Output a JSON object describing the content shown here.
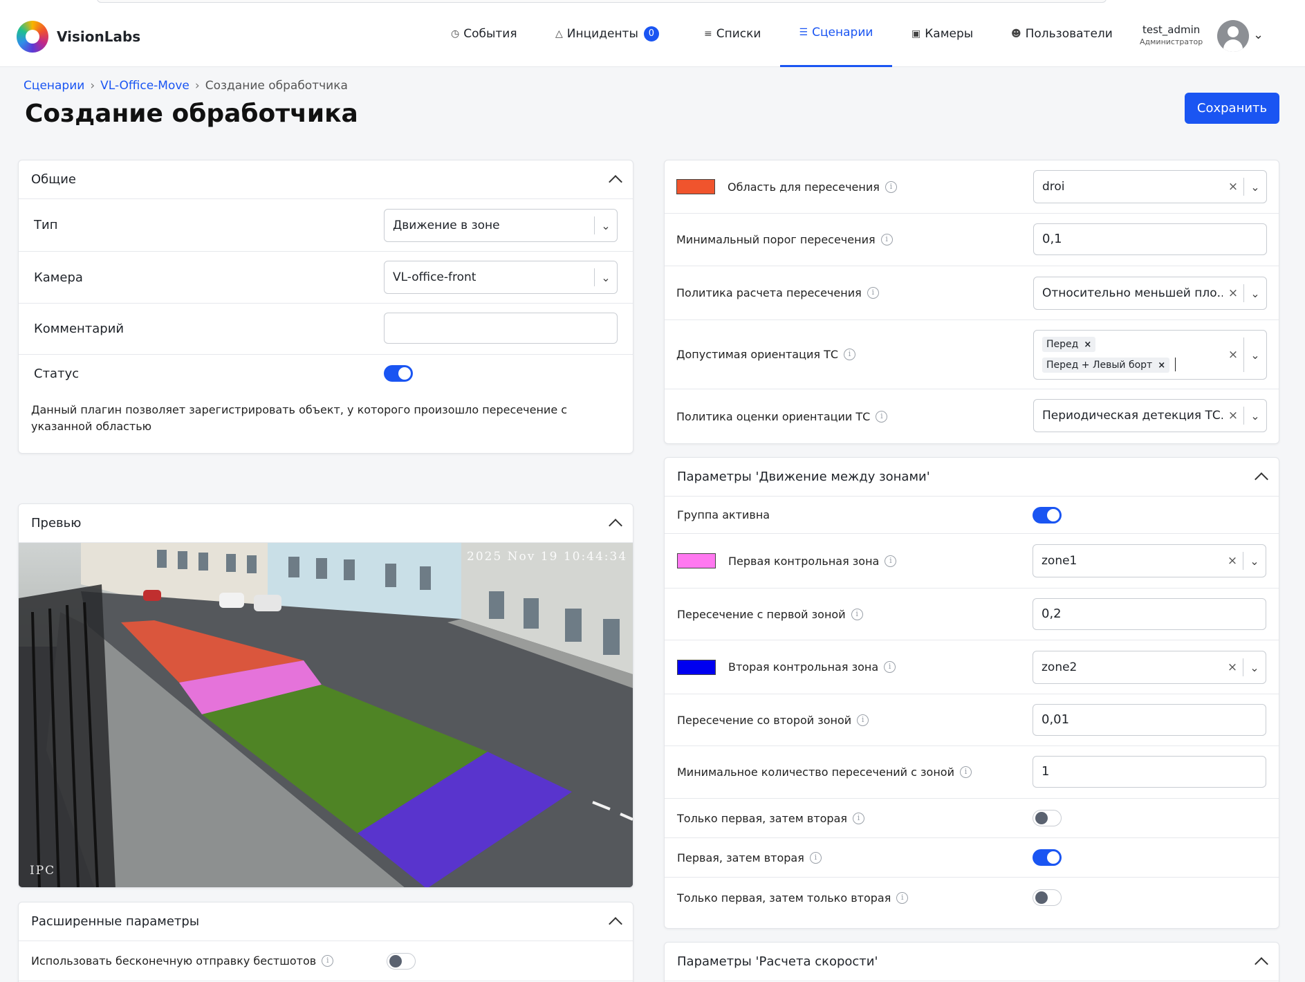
{
  "app": {
    "brand": "VisionLabs"
  },
  "nav": {
    "events": "События",
    "incidents": "Инциденты",
    "incidents_count": "0",
    "lists": "Списки",
    "scenarios": "Сценарии",
    "cameras": "Камеры",
    "users": "Пользователи"
  },
  "user": {
    "name": "test_admin",
    "role": "Администратор"
  },
  "breadcrumb": {
    "root": "Сценарии",
    "parent": "VL-Office-Move",
    "current": "Создание обработчика"
  },
  "page": {
    "title": "Создание обработчика",
    "save_label": "Сохранить"
  },
  "general": {
    "title": "Общие",
    "type_label": "Тип",
    "type_value": "Движение в зоне",
    "camera_label": "Камера",
    "camera_value": "VL-office-front",
    "comment_label": "Комментарий",
    "comment_value": "",
    "status_label": "Статус",
    "status_on": true,
    "description": "Данный плагин позволяет зарегистрировать объект, у которого произошло пересечение с указанной областью"
  },
  "preview": {
    "title": "Превью",
    "osd_time": "2025  Nov 19 10:44:34",
    "osd_cam": "IPC"
  },
  "advanced": {
    "title": "Расширенные параметры",
    "infinite_label": "Использовать бесконечную отправку бестшотов",
    "infinite_on": false
  },
  "intersection": {
    "area_label": "Область для пересечения",
    "area_color": "#f0542d",
    "area_value": "droi",
    "min_threshold_label": "Минимальный порог пересечения",
    "min_threshold_value": "0,1",
    "policy_label": "Политика расчета пересечения",
    "policy_value": "Относительно меньшей пло...",
    "orientation_label": "Допустимая ориентация ТС",
    "orientation_tags": [
      "Перед",
      "Перед + Левый борт"
    ],
    "orientation_policy_label": "Политика оценки ориентации ТС",
    "orientation_policy_value": "Периодическая детекция ТС..."
  },
  "between_zones": {
    "title": "Параметры 'Движение между зонами'",
    "group_active_label": "Группа активна",
    "group_active_on": true,
    "first_zone_label": "Первая контрольная зона",
    "first_zone_color": "#ff78f0",
    "first_zone_value": "zone1",
    "first_cross_label": "Пересечение с первой зоной",
    "first_cross_value": "0,2",
    "second_zone_label": "Вторая контрольная зона",
    "second_zone_color": "#0000f0",
    "second_zone_value": "zone2",
    "second_cross_label": "Пересечение со второй зоной",
    "second_cross_value": "0,01",
    "min_count_label": "Минимальное количество пересечений с зоной",
    "min_count_value": "1",
    "only_first_then_second_label": "Только первая, затем вторая",
    "only_first_then_second_on": false,
    "first_then_second_label": "Первая, затем вторая",
    "first_then_second_on": true,
    "only_first_then_only_second_label": "Только первая, затем только вторая",
    "only_first_then_only_second_on": false
  },
  "speed": {
    "title": "Параметры 'Расчета скорости'"
  },
  "icons": {
    "events": "clock-icon",
    "incidents": "warning-triangle-icon",
    "lists": "list-icon",
    "scenarios": "sliders-icon",
    "cameras": "camera-icon",
    "users": "users-icon"
  }
}
